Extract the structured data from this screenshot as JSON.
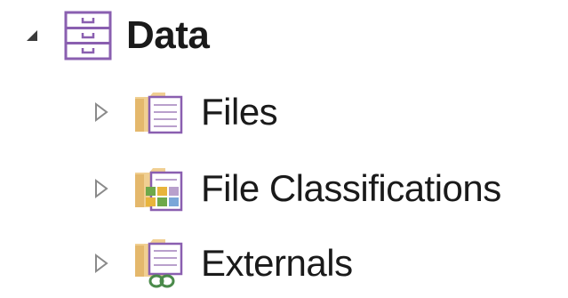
{
  "tree": {
    "root": {
      "label": "Data",
      "expanded": true,
      "icon": "cabinet-drawers-icon"
    },
    "children": [
      {
        "label": "Files",
        "expanded": false,
        "icon": "folder-document-icon"
      },
      {
        "label": "File Classifications",
        "expanded": false,
        "icon": "folder-classification-icon"
      },
      {
        "label": "Externals",
        "expanded": false,
        "icon": "folder-link-icon"
      }
    ]
  },
  "colors": {
    "accent_purple": "#8a5fb0",
    "folder_tan": "#e8c98a",
    "expander_gray": "#8a8a8a"
  }
}
